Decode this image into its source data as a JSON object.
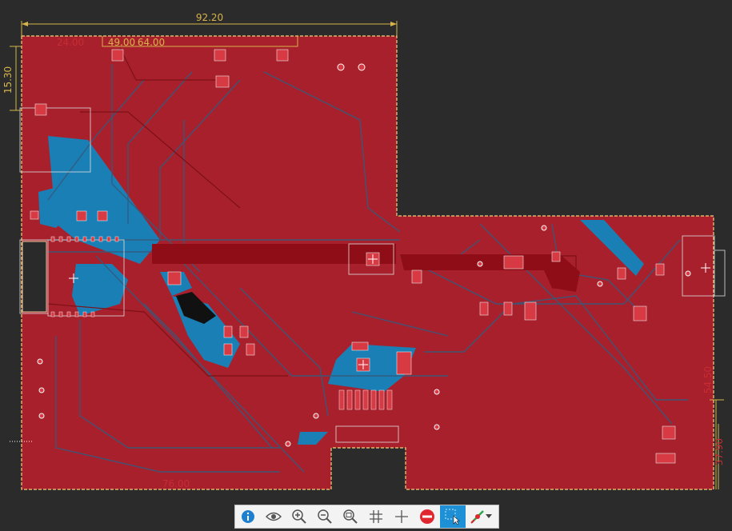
{
  "dimensions": {
    "board_width": "92.20",
    "top_left_offset": "24.00",
    "top_pair_a": "49.00",
    "top_pair_b": "64.00",
    "left_height": "15.30",
    "bottom_width": "76.00",
    "right_height_a": "54.50",
    "right_height_b": "37.90"
  },
  "colors": {
    "background": "#2b2b2b",
    "copper_top": "#a8202c",
    "copper_bottom": "#1a7fb5",
    "dimension": "#d6b44a",
    "outline": "#f2d27a"
  },
  "toolbar": {
    "buttons": [
      {
        "icon": "info-icon",
        "active": false
      },
      {
        "icon": "eye-icon",
        "active": false
      },
      {
        "icon": "zoom-in-icon",
        "active": false
      },
      {
        "icon": "zoom-out-icon",
        "active": false
      },
      {
        "icon": "zoom-fit-icon",
        "active": false
      },
      {
        "icon": "grid-icon",
        "active": false
      },
      {
        "icon": "crosshair-icon",
        "active": false
      },
      {
        "icon": "no-entry-icon",
        "active": false
      },
      {
        "icon": "select-pointer-icon",
        "active": true
      },
      {
        "icon": "highlight-net-icon",
        "active": false
      }
    ]
  }
}
